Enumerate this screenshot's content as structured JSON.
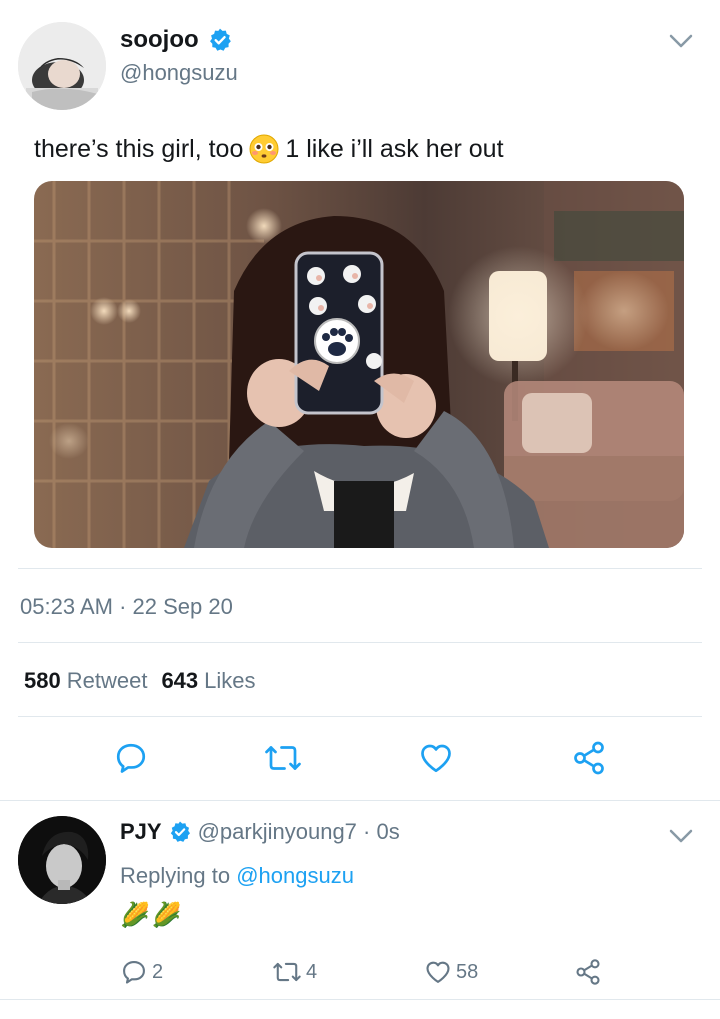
{
  "tweet": {
    "display_name": "soojoo",
    "verified_icon": "verified-badge-icon",
    "handle": "@hongsuzu",
    "text_before_emoji": "there’s this girl, too",
    "emoji": "flushed-face-emoji",
    "text_after_emoji": "1 like i’ll ask her out",
    "photo": "photo-girl-holding-phone-with-dog-case",
    "timestamp": "05:23 AM · 22 Sep 20",
    "retweet_count": "580",
    "retweet_label": "Retweet",
    "likes_count": "643",
    "likes_label": "Likes",
    "actions": [
      "reply-icon",
      "retweet-icon",
      "like-icon",
      "share-icon"
    ]
  },
  "reply": {
    "display_name": "PJY",
    "verified_icon": "verified-badge-icon",
    "handle_time": "@parkjinyoung7 · 0s",
    "replying_prefix": "Replying to",
    "replying_handle": "@hongsuzu",
    "body": "🌽🌽",
    "reply_count": "2",
    "retweet_count": "4",
    "like_count": "58"
  },
  "colors": {
    "accent": "#1da1f2",
    "secondary_text": "#657786",
    "primary_text": "#14171a",
    "divider": "#e1e8ed"
  }
}
